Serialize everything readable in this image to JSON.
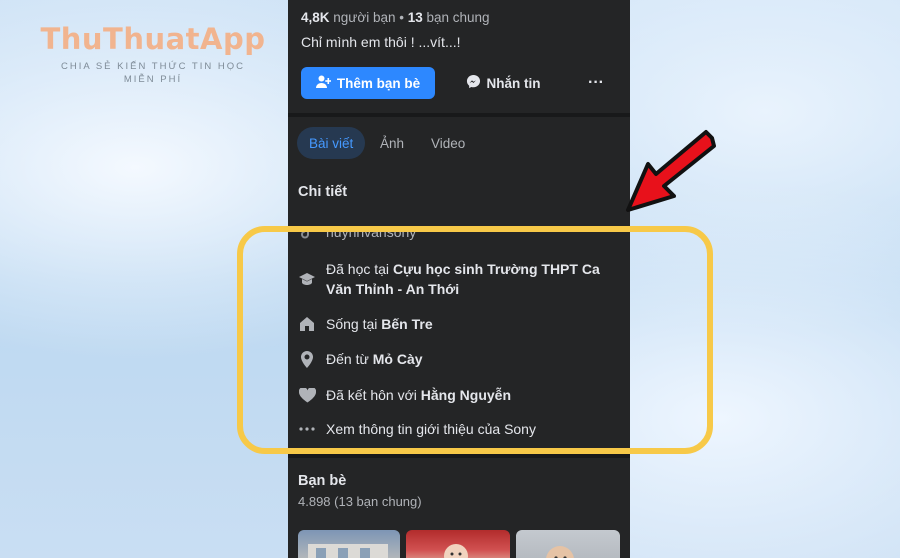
{
  "watermark": {
    "title": "ThuThuatApp",
    "subtitle_line1": "CHIA SẺ KIẾN THỨC TIN HỌC",
    "subtitle_line2": "MIỄN PHÍ"
  },
  "profile": {
    "followers_count": "4,8K",
    "followers_label": " người bạn",
    "dot": " • ",
    "mutual_count": "13",
    "mutual_label": " bạn chung",
    "bio": "Chỉ mình em thôi !  ...vít...!"
  },
  "actions": {
    "add_friend": "Thêm bạn bè",
    "message": "Nhắn tin",
    "more": "···"
  },
  "tabs": [
    {
      "label": "Bài viết",
      "active": true
    },
    {
      "label": "Ảnh",
      "active": false
    },
    {
      "label": "Video",
      "active": false
    }
  ],
  "details": {
    "title": "Chi tiết",
    "tiktok": "huynhvansony",
    "studied_prefix": "Đã học tại ",
    "studied_line1": "Cựu học sinh Trường THPT Ca",
    "studied_line2": "Văn Thỉnh - An Thới",
    "lives_prefix": "Sống tại ",
    "lives_place": "Bến Tre",
    "from_prefix": "Đến từ ",
    "from_place": "Mỏ Cày",
    "married_prefix": "Đã kết hôn với ",
    "married_name": "Hằng Nguyễn",
    "see_more": "Xem thông tin giới thiệu của Sony"
  },
  "friends": {
    "title": "Bạn bè",
    "count": "4.898 (13 bạn chung)"
  },
  "colors": {
    "accent": "#2d88ff",
    "highlight": "#f7c948",
    "arrow": "#e8111b"
  }
}
